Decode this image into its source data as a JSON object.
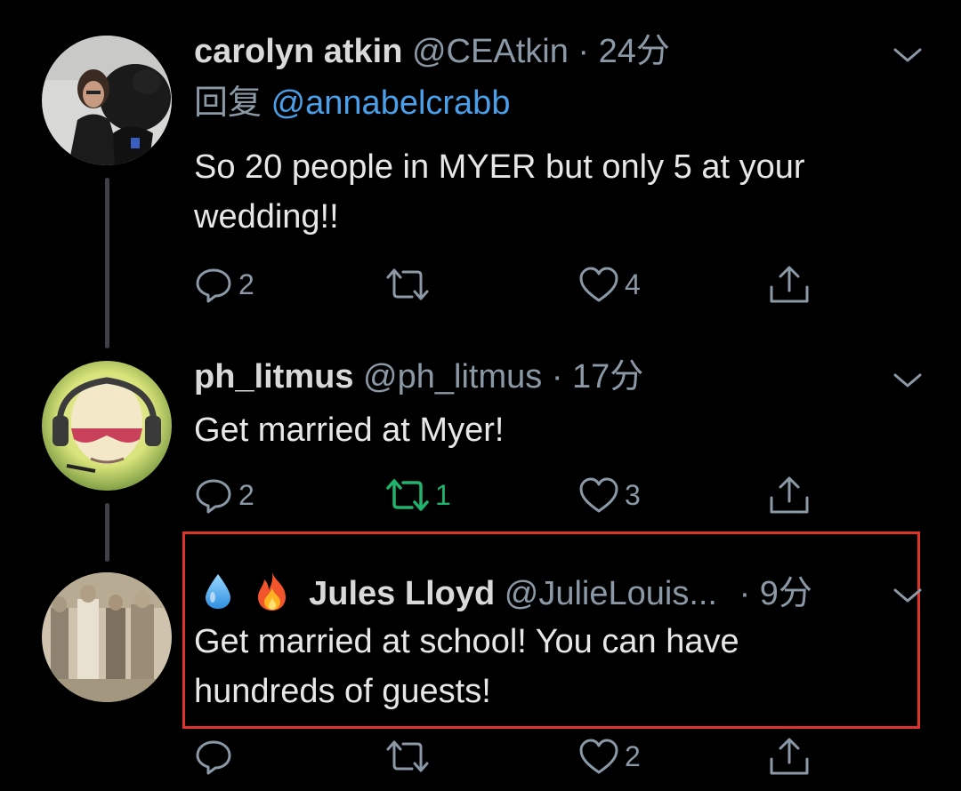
{
  "colors": {
    "background": "#000000",
    "name": "#d9d9d9",
    "secondary": "#8b98a5",
    "mention": "#4a9fe8",
    "retweet_active": "#20b36b",
    "highlight": "#e0322c"
  },
  "tweets": [
    {
      "display_name": "carolyn atkin",
      "handle": "@CEAtkin",
      "dot": "·",
      "time": "24分",
      "reply_prefix": "回复",
      "reply_to": "@annabelcrabb",
      "text": "So 20 people in MYER but only 5 at your wedding!!",
      "replies": "2",
      "retweets": "",
      "likes": "4",
      "icons": [
        "reply-icon",
        "retweet-icon",
        "like-icon",
        "share-icon"
      ]
    },
    {
      "display_name": "ph_litmus",
      "handle": "@ph_litmus",
      "dot": "·",
      "time": "17分",
      "text": "Get married at Myer!",
      "replies": "2",
      "retweets": "1",
      "likes": "3",
      "icons": [
        "reply-icon",
        "retweet-icon",
        "like-icon",
        "share-icon"
      ]
    },
    {
      "emoji_prefix": [
        "droplet-icon",
        "fire-icon"
      ],
      "display_name": "Jules Lloyd",
      "handle": "@JulieLouis...",
      "dot": "·",
      "time": "9分",
      "text": "Get married at school! You can have hundreds of guests!",
      "replies": "",
      "retweets": "",
      "likes": "2",
      "icons": [
        "reply-icon",
        "retweet-icon",
        "like-icon",
        "share-icon"
      ]
    }
  ]
}
